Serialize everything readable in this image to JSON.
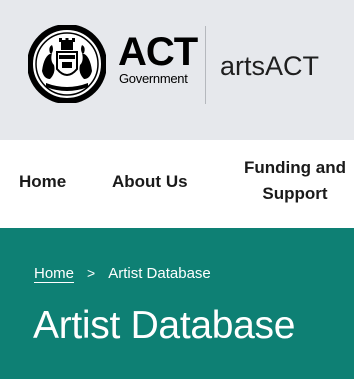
{
  "header": {
    "logo": {
      "primary": "ACT",
      "secondary": "Government"
    },
    "site_name": "artsACT"
  },
  "nav": {
    "items": [
      {
        "label": "Home"
      },
      {
        "label": "About Us"
      },
      {
        "label_line1": "Funding and",
        "label_line2": "Support"
      }
    ]
  },
  "breadcrumb": {
    "home": "Home",
    "separator": ">",
    "current": "Artist Database"
  },
  "page": {
    "title": "Artist Database"
  },
  "colors": {
    "header_bg": "#e6e8ec",
    "banner_bg": "#0e8074",
    "text_dark": "#1a1a1a",
    "text_light": "#ffffff"
  },
  "icons": {
    "seal": "act-coat-of-arms-seal-icon"
  }
}
